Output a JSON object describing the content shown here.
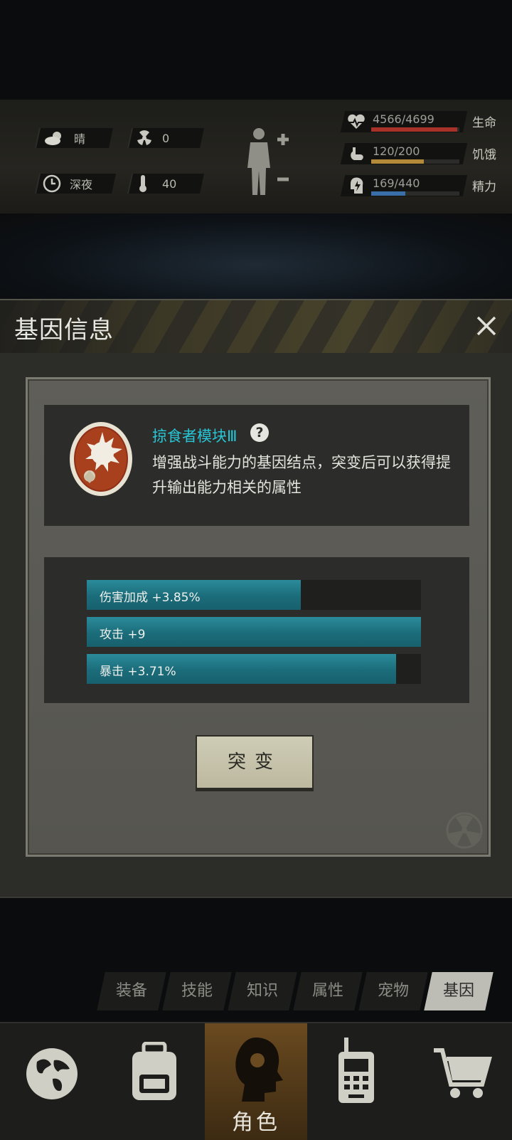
{
  "status": {
    "weather": {
      "icon": "cloud-sun-icon",
      "label": "晴"
    },
    "radiation": {
      "icon": "radiation-icon",
      "value": "0"
    },
    "time": {
      "icon": "clock-icon",
      "label": "深夜"
    },
    "temperature": {
      "icon": "thermometer-icon",
      "value": "40"
    },
    "vitals": [
      {
        "icon": "heart-icon",
        "text": "4566/4699",
        "label": "生命",
        "fraction": 0.972,
        "color": "#a8322a"
      },
      {
        "icon": "stomach-icon",
        "text": "120/200",
        "label": "饥饿",
        "fraction": 0.6,
        "color": "#b38a3a"
      },
      {
        "icon": "energy-icon",
        "text": "169/440",
        "label": "精力",
        "fraction": 0.384,
        "color": "#3a6ea8"
      }
    ]
  },
  "modal": {
    "title": "基因信息",
    "gene": {
      "name": "掠食者模块Ⅲ",
      "description": "增强战斗能力的基因结点，突变后可以获得提升输出能力相关的属性"
    },
    "stats": [
      {
        "label": "伤害加成 +3.85%",
        "fraction": 0.64
      },
      {
        "label": "攻击 +9",
        "fraction": 1.0
      },
      {
        "label": "暴击 +3.71%",
        "fraction": 0.925
      }
    ],
    "mutate_label": "突变"
  },
  "tabs": [
    {
      "label": "装备",
      "active": false
    },
    {
      "label": "技能",
      "active": false
    },
    {
      "label": "知识",
      "active": false
    },
    {
      "label": "属性",
      "active": false
    },
    {
      "label": "宠物",
      "active": false
    },
    {
      "label": "基因",
      "active": true
    }
  ],
  "nav": [
    {
      "icon": "globe-icon",
      "label": ""
    },
    {
      "icon": "backpack-icon",
      "label": ""
    },
    {
      "icon": "character-head-icon",
      "label": "角色",
      "active": true
    },
    {
      "icon": "walkie-talkie-icon",
      "label": ""
    },
    {
      "icon": "cart-icon",
      "label": ""
    }
  ]
}
